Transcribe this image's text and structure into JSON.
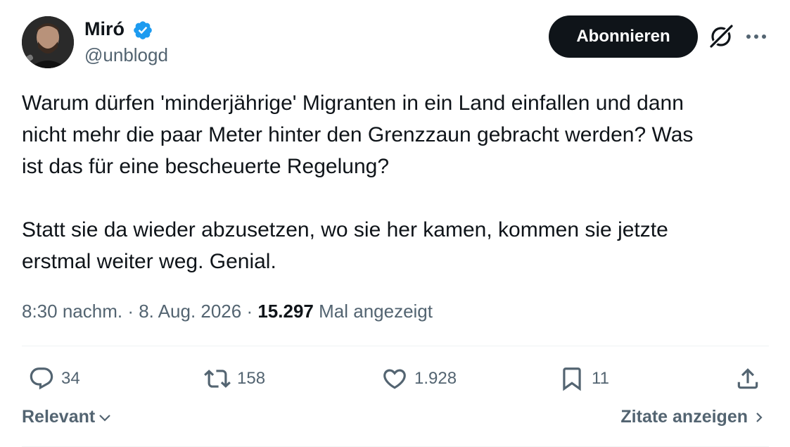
{
  "author": {
    "name": "Miró",
    "handle": "@unblogd"
  },
  "header": {
    "subscribe_label": "Abonnieren"
  },
  "tweet": {
    "text": "Warum dürfen 'minderjährige' Migranten in ein Land einfallen und dann\nnicht mehr die paar Meter hinter den Grenzzaun gebracht werden? Was\nist das für eine bescheuerte Regelung?\n\nStatt sie da wieder abzusetzen, wo sie her kamen, kommen sie jetzte\nerstmal weiter weg. Genial.",
    "time": "8:30 nachm.",
    "separator": " · ",
    "date": "8. Aug. 2026",
    "views_count": "15.297",
    "views_label": "Mal angezeigt"
  },
  "actions": {
    "replies": "34",
    "reposts": "158",
    "likes": "1.928",
    "bookmarks": "11"
  },
  "footer": {
    "sort_label": "Relevant",
    "quotes_label": "Zitate anzeigen"
  },
  "icons": [
    "verified-badge-icon",
    "grok-icon",
    "more-icon",
    "reply-icon",
    "repost-icon",
    "like-icon",
    "bookmark-icon",
    "share-icon",
    "chevron-down-icon",
    "chevron-right-icon"
  ],
  "colors": {
    "text": "#0f1419",
    "secondary": "#536471",
    "verified": "#1d9bf0",
    "button_bg": "#0f1419",
    "divider": "#eff3f4"
  }
}
